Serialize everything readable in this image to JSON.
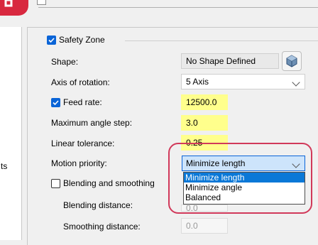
{
  "window": {
    "left_text": "ts"
  },
  "safety_zone": {
    "label": "Safety Zone",
    "checked": true
  },
  "shape": {
    "label": "Shape:",
    "value": "No Shape Defined",
    "button_icon": "cube-icon"
  },
  "axis_of_rotation": {
    "label": "Axis of rotation:",
    "value": "5 Axis"
  },
  "feed_rate": {
    "label": "Feed rate:",
    "value": "12500.0",
    "checked": true
  },
  "max_angle_step": {
    "label": "Maximum angle step:",
    "value": "3.0"
  },
  "linear_tolerance": {
    "label": "Linear tolerance:",
    "value": "0.25"
  },
  "motion_priority": {
    "label": "Motion priority:",
    "value": "Minimize length",
    "options": [
      "Minimize length",
      "Minimize angle",
      "Balanced"
    ],
    "selected_index": 0
  },
  "blending_and_smoothing": {
    "label": "Blending and smoothing",
    "checked": false
  },
  "blending_distance": {
    "label": "Blending distance:",
    "value": "0.0"
  },
  "smoothing_distance": {
    "label": "Smoothing distance:",
    "value": "0.0"
  },
  "colors": {
    "accent": "#0a64d7",
    "highlight_field": "#ffff8c",
    "annotation": "#d1395a"
  }
}
